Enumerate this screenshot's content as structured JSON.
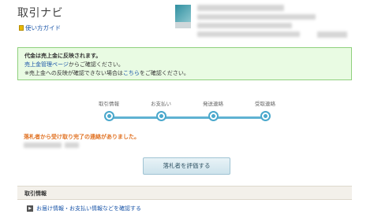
{
  "header": {
    "title": "取引ナビ",
    "guide_label": "使い方ガイド"
  },
  "notice": {
    "line1": "代金は売上金に反映されます。",
    "line2_link": "売上金管理ページ",
    "line2_text": "からご確認ください。",
    "line3_pre": "※売上金への反映が確認できない場合は",
    "line3_link": "こちら",
    "line3_post": "をご確認ください。"
  },
  "steps": [
    {
      "label": "取引情報"
    },
    {
      "label": "お支払い"
    },
    {
      "label": "発送連絡"
    },
    {
      "label": "受取連絡"
    }
  ],
  "status_text": "落札者から受け取り完了の連絡がありました。",
  "rate_button_label": "落札者を評価する",
  "section": {
    "title": "取引情報",
    "link_label": "お届け情報・お支払い情報などを確認する"
  },
  "colors": {
    "accent": "#4aa8cc",
    "notice_bg": "#e9fbe3",
    "status": "#e07020",
    "link": "#1a55a8"
  }
}
